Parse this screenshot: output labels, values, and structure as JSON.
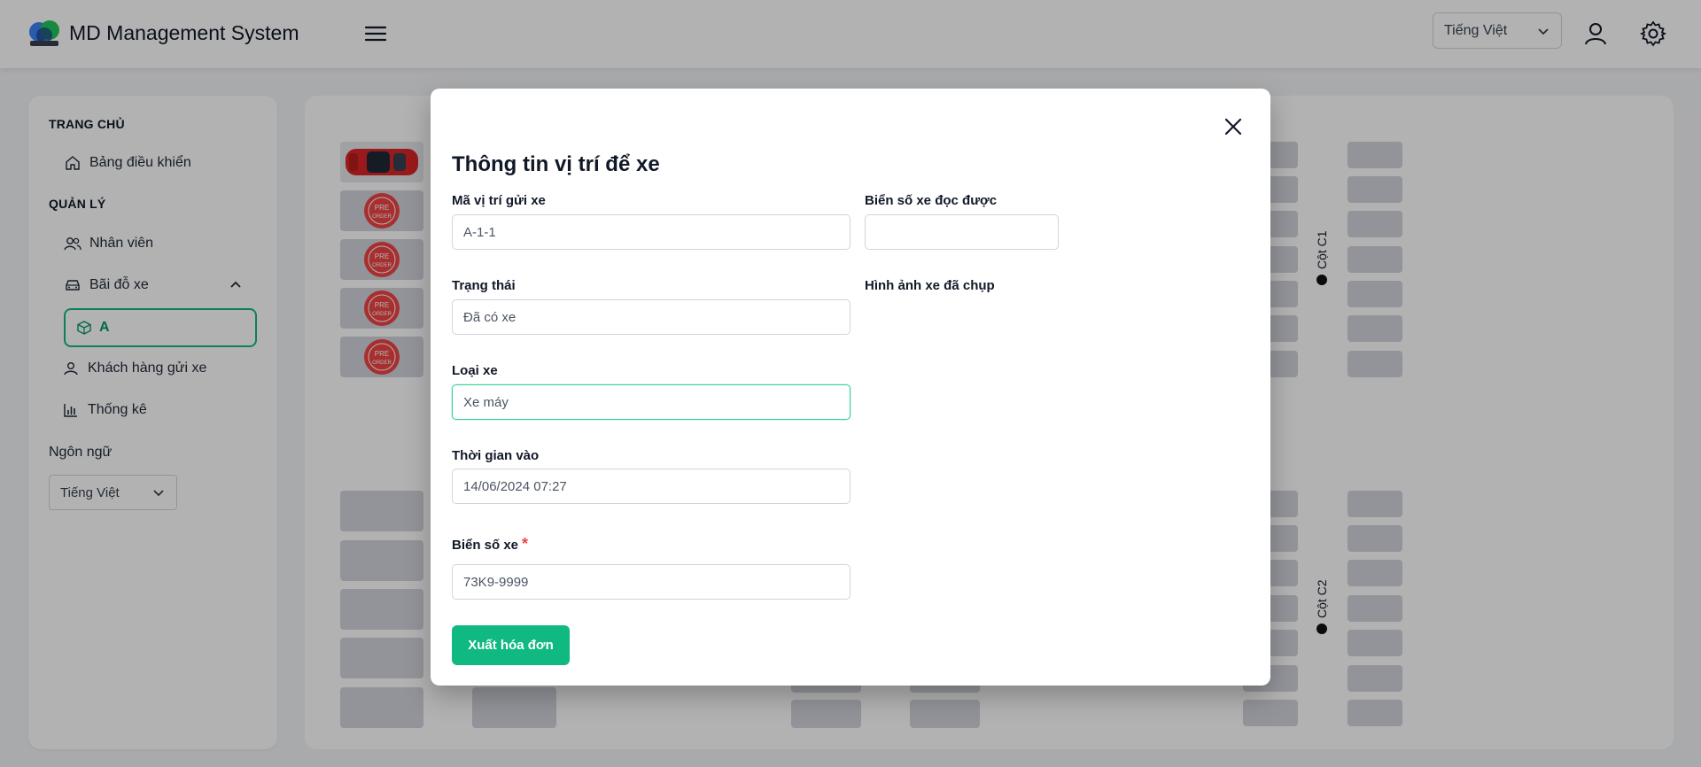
{
  "header": {
    "title": "MD Management System",
    "language": "Tiếng Việt"
  },
  "sidebar": {
    "section_home": "TRANG CHỦ",
    "dashboard": "Bảng điều khiển",
    "section_manage": "QUẢN LÝ",
    "staff": "Nhân viên",
    "parking": "Bãi đỗ xe",
    "parking_active_sub": "A",
    "customers": "Khách hàng gửi xe",
    "stats": "Thống kê",
    "language_label": "Ngôn ngữ",
    "language_value": "Tiếng Việt"
  },
  "parking_map": {
    "column_1": "Cột C1",
    "column_2": "Cột C2",
    "preorder_text": "PRE ORDER"
  },
  "modal": {
    "title": "Thông tin vị trí để xe",
    "slot_code_label": "Mã vị trí gửi xe",
    "slot_code_value": "A-1-1",
    "plate_read_label": "Biển số xe đọc được",
    "plate_read_value": "",
    "status_label": "Trạng thái",
    "status_value": "Đã có xe",
    "captured_image_label": "Hình ảnh xe đã chụp",
    "vehicle_type_label": "Loại xe",
    "vehicle_type_value": "Xe máy",
    "time_in_label": "Thời gian vào",
    "time_in_value": "14/06/2024 07:27",
    "plate_label": "Biển số xe",
    "required_mark": "*",
    "plate_value": "73K9-9999",
    "invoice_button": "Xuất hóa đơn"
  },
  "colors": {
    "accent": "#10b981",
    "required": "#ef4444"
  }
}
